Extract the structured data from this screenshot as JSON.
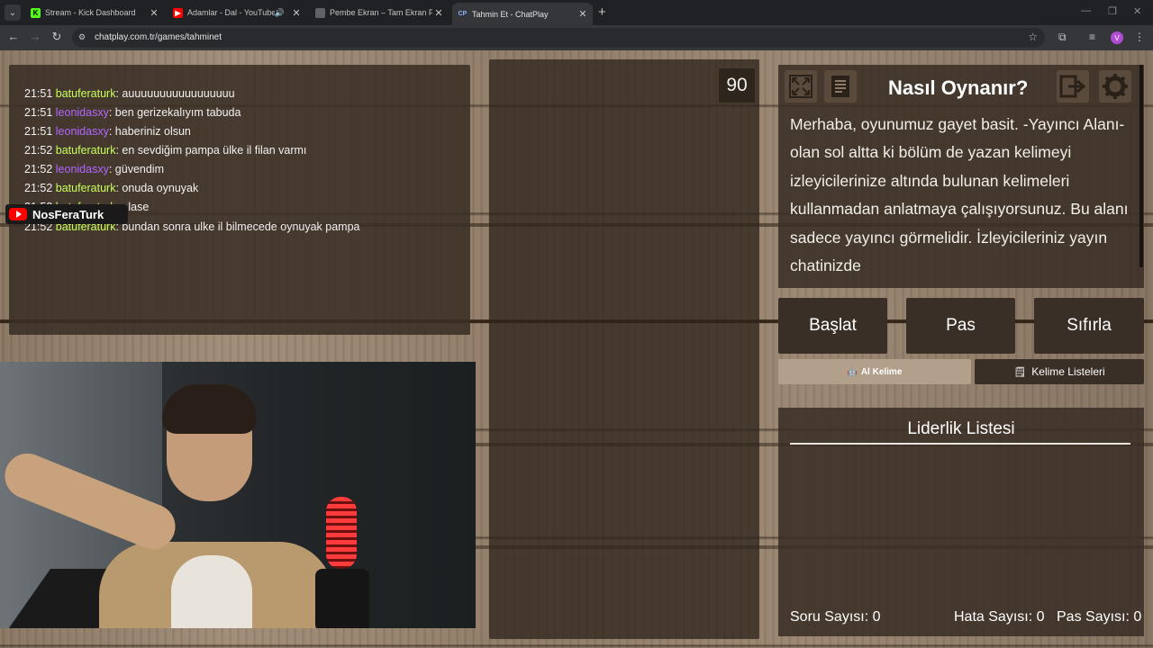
{
  "browser": {
    "tabs": [
      {
        "title": "Stream - Kick Dashboard",
        "favicon": "kick-icon",
        "color": "#53fc18"
      },
      {
        "title": "Adamlar - Dal - YouTube",
        "favicon": "youtube-icon",
        "color": "#ff0000"
      },
      {
        "title": "Pembe Ekran – Tam Ekran Pink",
        "favicon": "page-icon",
        "color": "#555555"
      },
      {
        "title": "Tahmin Et - ChatPlay",
        "favicon": "chatplay-icon",
        "color": "#8ab4f8"
      }
    ],
    "active_tab": 3,
    "url": "chatplay.com.tr/games/tahminet",
    "profile_initial": "V"
  },
  "chat": {
    "messages": [
      {
        "time": "21:51",
        "user": "batuferaturk",
        "user_color": "#c8ff5a",
        "text": ": auuuuuuuuuuuuuuuuu"
      },
      {
        "time": "21:51",
        "user": "leonidasxy",
        "user_color": "#b266ff",
        "text": ": ben gerizekalıyım tabuda"
      },
      {
        "time": "21:51",
        "user": "leonidasxy",
        "user_color": "#b266ff",
        "text": ": haberiniz olsun"
      },
      {
        "time": "21:52",
        "user": "batuferaturk",
        "user_color": "#c8ff5a",
        "text": ": en sevdiğim pampa ülke il filan varmı"
      },
      {
        "time": "21:52",
        "user": "leonidasxy",
        "user_color": "#b266ff",
        "text": ": güvendim"
      },
      {
        "time": "21:52",
        "user": "batuferaturk",
        "user_color": "#c8ff5a",
        "text": ": onuda oynuyak"
      },
      {
        "time": "21:52",
        "user": "batuferaturk",
        "user_color": "#c8ff5a",
        "text": ": plase"
      },
      {
        "time": "21:52",
        "user": "batuferaturk",
        "user_color": "#c8ff5a",
        "text": ": bundan sonra ulke il bilmecede oynuyak pampa"
      }
    ]
  },
  "overlay": {
    "channel_name": "NosFeraTurk"
  },
  "game": {
    "timer": "90",
    "info_title": "Nasıl Oynanır?",
    "info_text": "Merhaba, oyunumuz gayet basit. -Yayıncı Alanı- olan sol altta ki bölüm de yazan kelimeyi izleyicilerinize altında bulunan kelimeleri kullanmadan anlatmaya çalışıyorsunuz. Bu alanı sadece yayıncı görmelidir. İzleyicileriniz yayın chatinizde",
    "buttons": {
      "start": "Başlat",
      "pass": "Pas",
      "reset": "Sıfırla"
    },
    "get_word": "Al Kelime",
    "word_lists": "Kelime Listeleri",
    "leaderboard_title": "Liderlik Listesi",
    "stats": {
      "questions_label": "Soru Sayısı:",
      "questions": "0",
      "errors_label": "Hata Sayısı:",
      "errors": "0",
      "passes_label": "Pas Sayısı:",
      "passes": "0"
    }
  }
}
